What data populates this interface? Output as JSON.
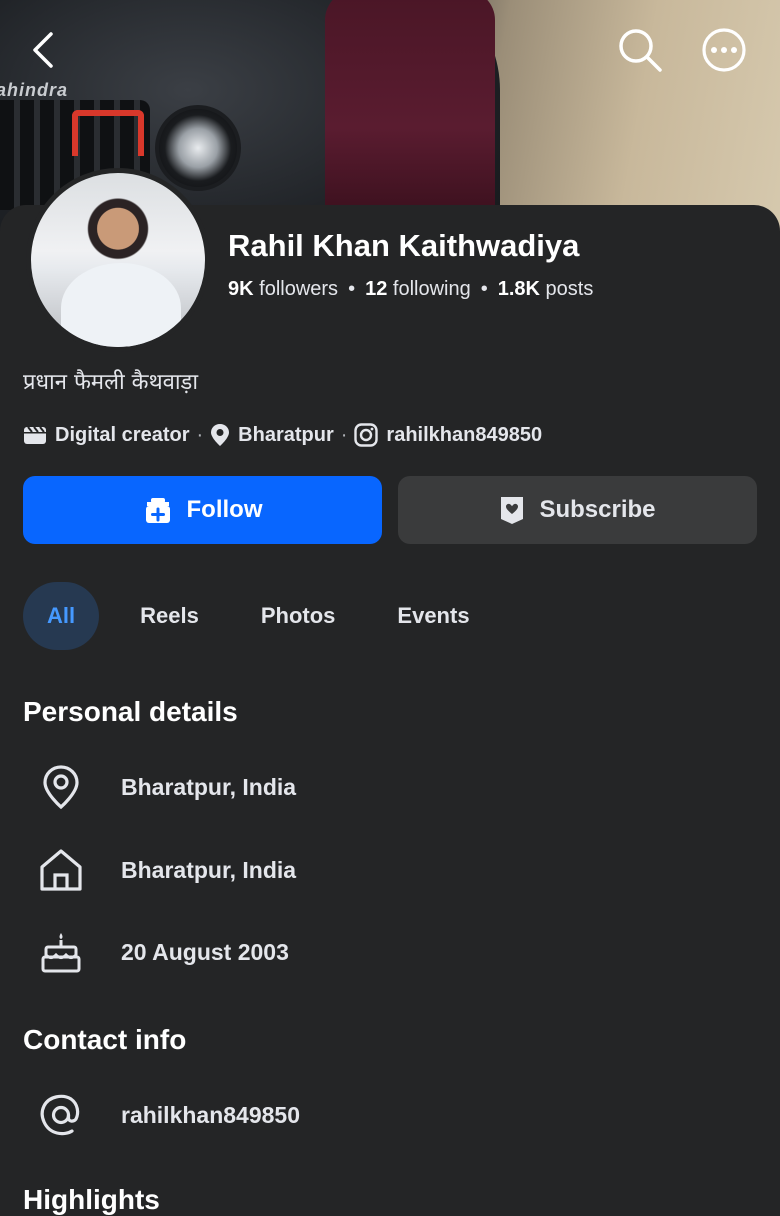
{
  "cover": {
    "brand_text": "Mahindra"
  },
  "profile": {
    "name": "Rahil Khan Kaithwadiya",
    "followers_count": "9K",
    "followers_label": "followers",
    "following_count": "12",
    "following_label": "following",
    "posts_count": "1.8K",
    "posts_label": "posts",
    "separator": "•",
    "bio": "प्रधान फैमली कैथवाड़ा"
  },
  "meta": {
    "category": "Digital creator",
    "location": "Bharatpur",
    "instagram": "rahilkhan849850",
    "dot": "·"
  },
  "actions": {
    "follow_label": "Follow",
    "subscribe_label": "Subscribe"
  },
  "tabs": [
    {
      "label": "All",
      "active": true
    },
    {
      "label": "Reels",
      "active": false
    },
    {
      "label": "Photos",
      "active": false
    },
    {
      "label": "Events",
      "active": false
    }
  ],
  "personal_details": {
    "title": "Personal details",
    "items": [
      {
        "icon": "location-pin-icon",
        "text": "Bharatpur, India"
      },
      {
        "icon": "home-icon",
        "text": "Bharatpur, India"
      },
      {
        "icon": "birthday-cake-icon",
        "text": "20 August 2003"
      }
    ]
  },
  "contact_info": {
    "title": "Contact info",
    "items": [
      {
        "icon": "at-sign-icon",
        "text": "rahilkhan849850"
      }
    ]
  },
  "highlights": {
    "title": "Highlights"
  },
  "colors": {
    "background": "#242526",
    "accent": "#0866ff",
    "active_tab_bg": "#263951",
    "active_tab_text": "#4599ff",
    "secondary_button": "#3a3b3c"
  }
}
